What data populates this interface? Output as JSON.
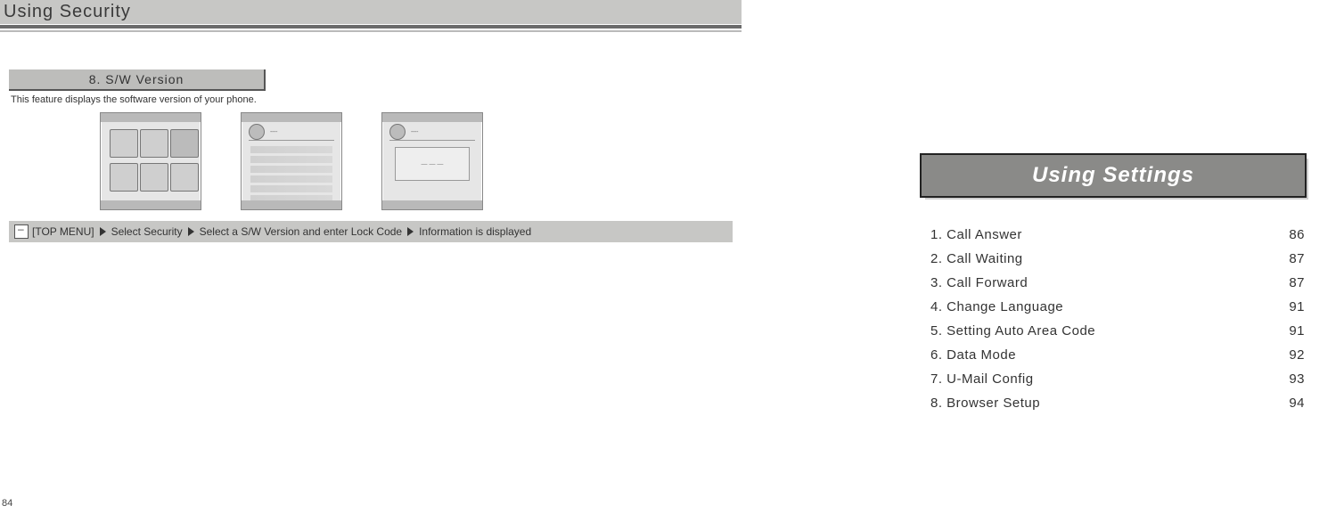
{
  "left": {
    "title": "Using Security",
    "section_label": "8. S/W Version",
    "desc": "This feature displays the software version of your phone.",
    "path_parts": {
      "a": "[TOP MENU]",
      "b": "Select Security",
      "c": "Select a S/W Version and enter Lock Code",
      "d": "Information is displayed"
    },
    "page_number": "84"
  },
  "right": {
    "heading": "Using Settings",
    "toc": [
      {
        "label": "1. Call Answer",
        "page": "86"
      },
      {
        "label": "2. Call Waiting",
        "page": "87"
      },
      {
        "label": "3. Call Forward",
        "page": "87"
      },
      {
        "label": "4. Change Language",
        "page": "91"
      },
      {
        "label": "5. Setting Auto Area Code",
        "page": "91"
      },
      {
        "label": "6. Data Mode",
        "page": "92"
      },
      {
        "label": "7. U-Mail Config",
        "page": "93"
      },
      {
        "label": "8. Browser Setup",
        "page": "94"
      }
    ]
  }
}
